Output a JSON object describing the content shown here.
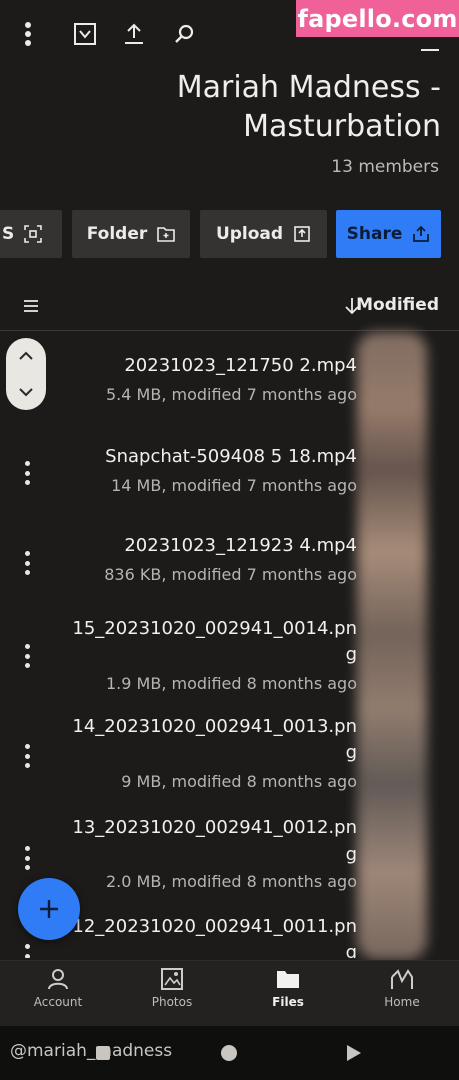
{
  "watermark": "fapello.com",
  "header": {
    "title_line1": "Mariah Madness -",
    "title_line2": "Masturbation",
    "members": "13 members"
  },
  "actions": {
    "share": "Share",
    "upload": "Upload",
    "folder": "Folder",
    "select_partial": "S"
  },
  "sort": {
    "label": "Modified"
  },
  "files": [
    {
      "name": "20231023_121750 2.mp4",
      "meta": "5.4 MB, modified 7 months ago"
    },
    {
      "name": "Snapchat-509408 5 18.mp4",
      "meta": "14 MB, modified 7 months ago"
    },
    {
      "name": "20231023_121923 4.mp4",
      "meta": "836 KB, modified 7 months ago"
    },
    {
      "name": "15_20231020_002941_0014.pn",
      "name2": "g",
      "meta": "1.9 MB, modified 8 months ago"
    },
    {
      "name": "14_20231020_002941_0013.pn",
      "name2": "g",
      "meta": "9 MB, modified 8 months ago"
    },
    {
      "name": "13_20231020_002941_0012.pn",
      "name2": "g",
      "meta": "2.0 MB, modified 8 months ago"
    },
    {
      "name": "12_20231020_002941_0011.pn",
      "name2": "g",
      "meta": ""
    }
  ],
  "nav": {
    "home": "Home",
    "files": "Files",
    "photos": "Photos",
    "account": "Account"
  },
  "system": {
    "handle": "@mariah_madness"
  }
}
